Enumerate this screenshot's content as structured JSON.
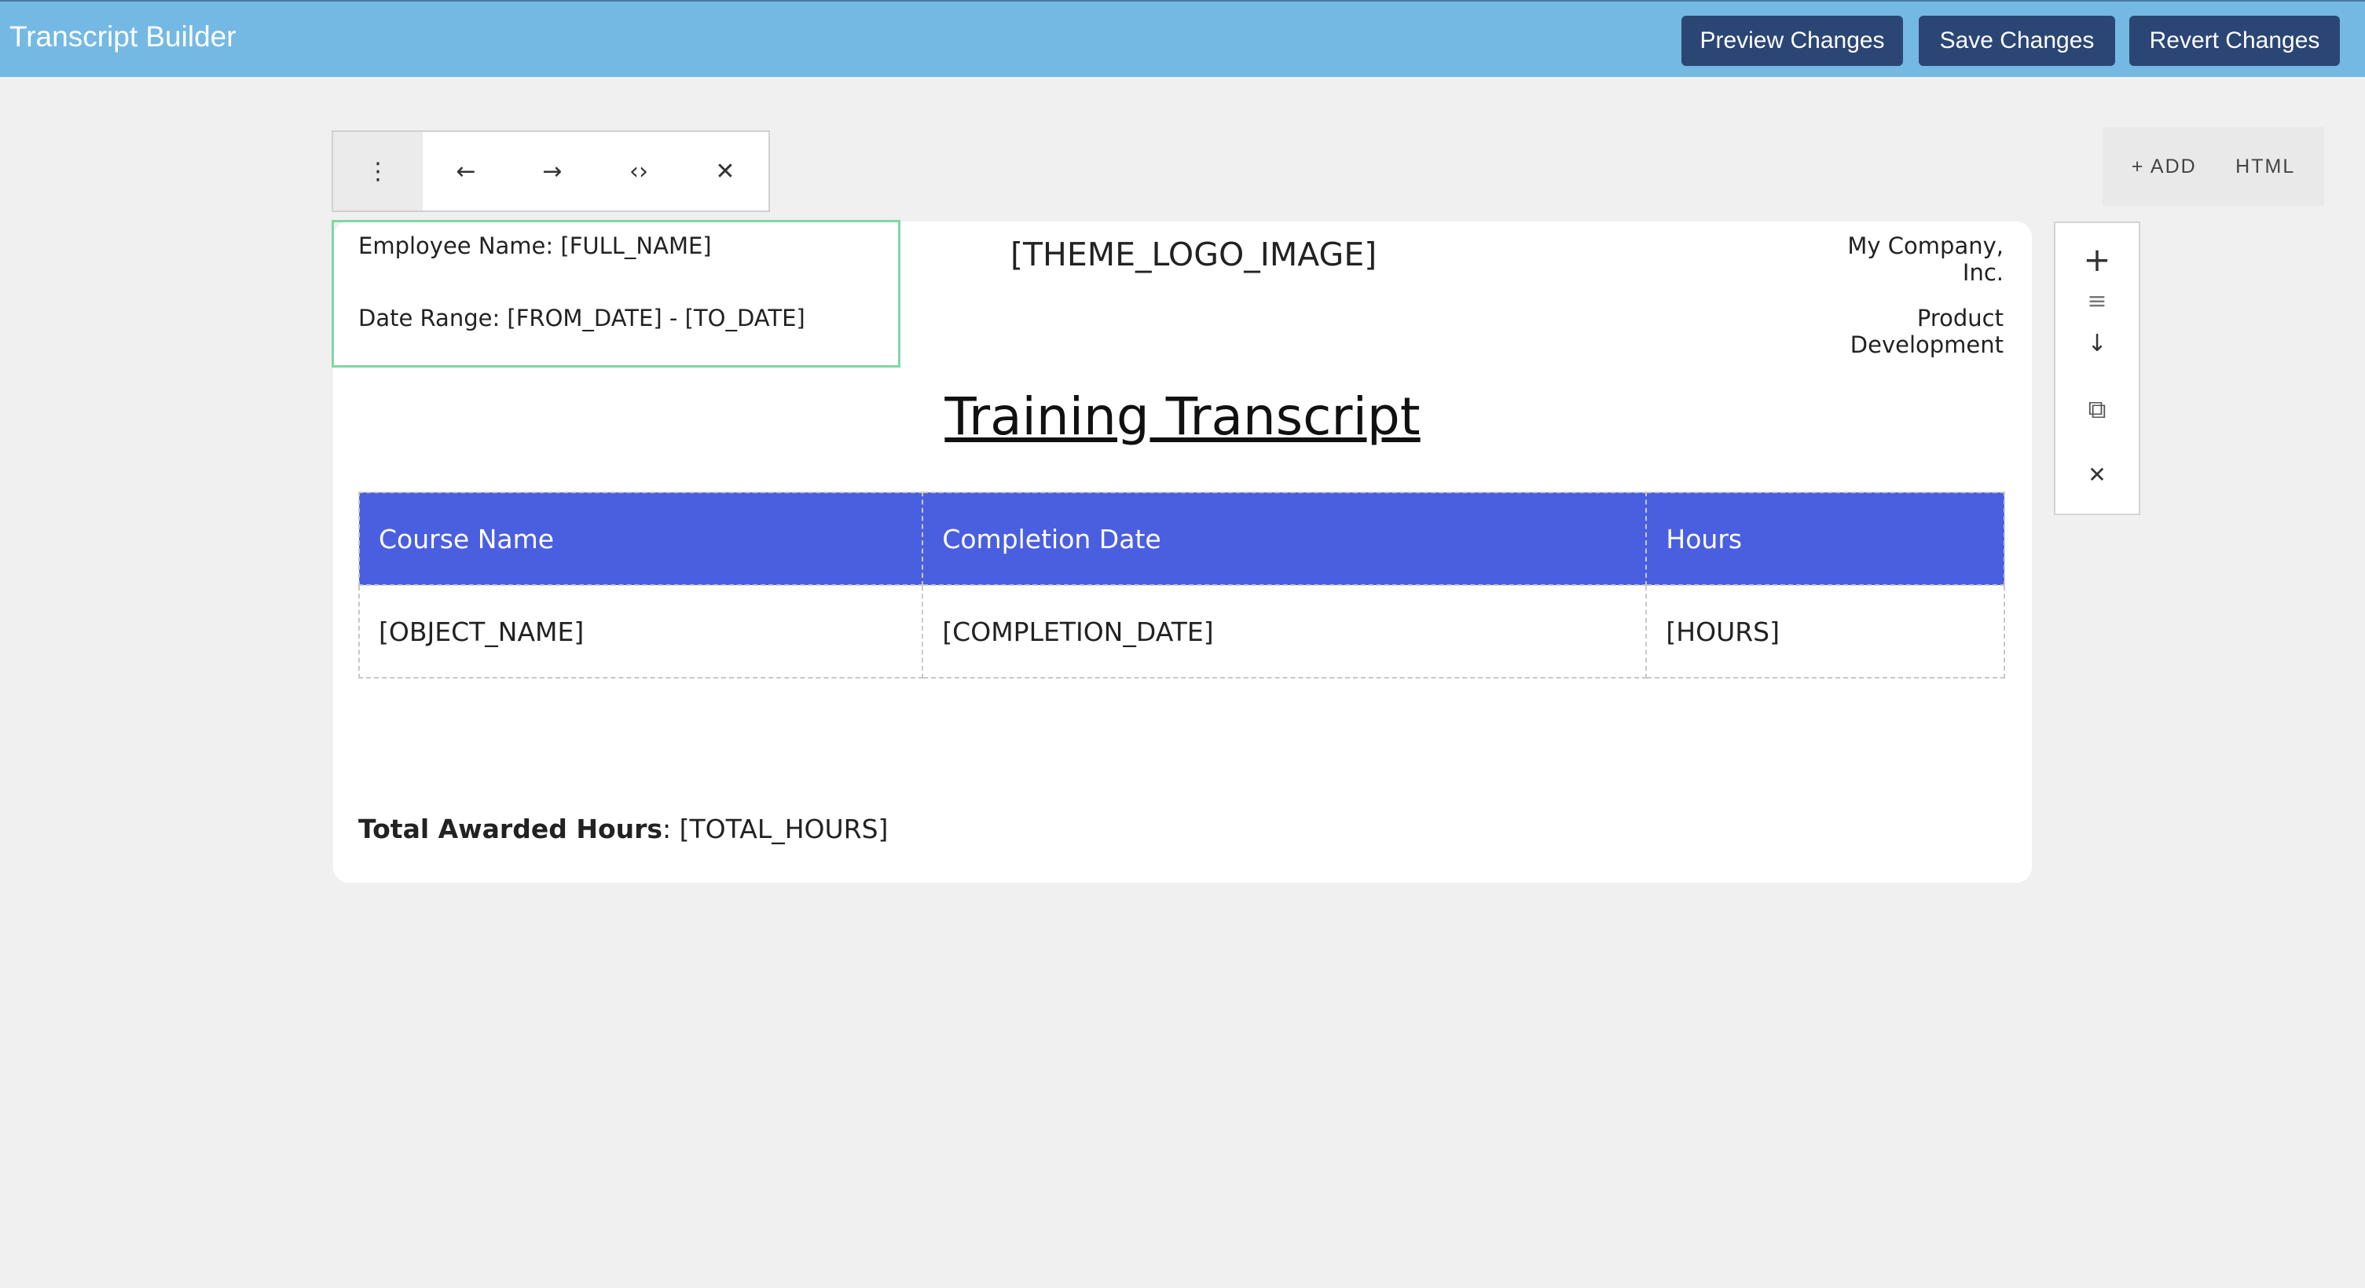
{
  "app": {
    "title": "Transcript Builder"
  },
  "header_buttons": {
    "preview": "Preview Changes",
    "save": "Save Changes",
    "revert": "Revert Changes"
  },
  "editor_toolbar": {
    "icons": [
      "more-vertical-icon",
      "arrow-left-icon",
      "arrow-right-icon",
      "code-icon",
      "close-icon"
    ],
    "glyphs": [
      "⋮",
      "←",
      "→",
      "‹›",
      "✕"
    ]
  },
  "add_panel": {
    "add_label": "+ ADD",
    "html_label": "HTML"
  },
  "document": {
    "employee_line": "Employee Name: [FULL_NAME]",
    "date_range_line": "Date Range: [FROM_DATE] - [TO_DATE]",
    "logo_placeholder": "[THEME_LOGO_IMAGE]",
    "company": "My Company, Inc.",
    "department": "Product Development",
    "title": "Training Transcript",
    "table": {
      "headers": [
        "Course Name",
        "Completion Date",
        "Hours"
      ],
      "rows": [
        [
          "[OBJECT_NAME]",
          "[COMPLETION_DATE]",
          "[HOURS]"
        ]
      ]
    },
    "total_label": "Total Awarded Hours",
    "total_value": ": [TOTAL_HOURS]"
  },
  "side_tools": {
    "icons": [
      "plus-icon",
      "drag-handle-icon",
      "arrow-down-icon",
      "duplicate-icon",
      "close-icon"
    ],
    "glyphs": [
      "+",
      "≡",
      "↓",
      "⧉",
      "✕"
    ]
  },
  "colors": {
    "topbar": "#74b9e4",
    "button": "#2b4675",
    "table_header": "#4a5fdf",
    "selection": "#7fd8a6"
  }
}
